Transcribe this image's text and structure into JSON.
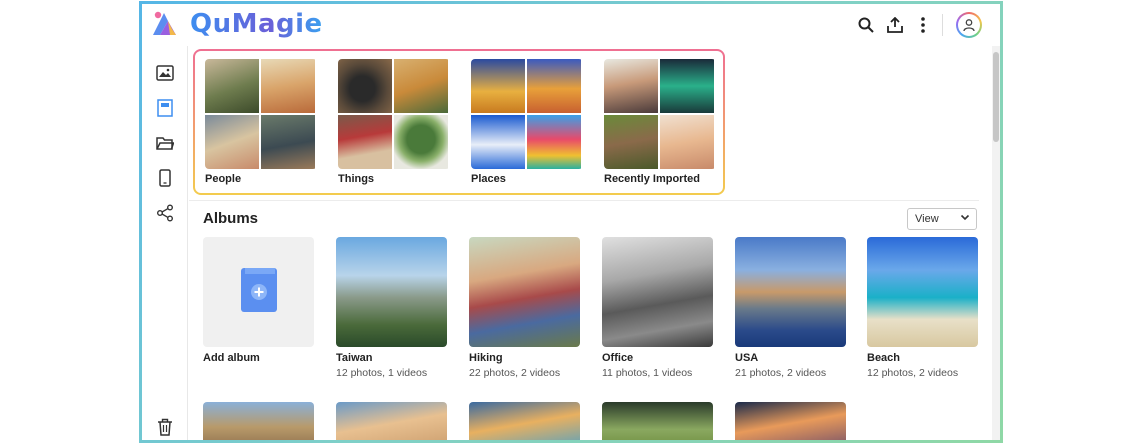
{
  "app": {
    "brand": "QuMagie"
  },
  "categories": [
    {
      "label": "People"
    },
    {
      "label": "Things"
    },
    {
      "label": "Places"
    },
    {
      "label": "Recently Imported"
    }
  ],
  "albums_section": {
    "title": "Albums",
    "view_label": "View"
  },
  "albums": [
    {
      "title": "Add album",
      "subtitle": ""
    },
    {
      "title": "Taiwan",
      "subtitle": "12 photos, 1 videos"
    },
    {
      "title": "Hiking",
      "subtitle": "22 photos, 2 videos"
    },
    {
      "title": "Office",
      "subtitle": "11 photos, 1 videos"
    },
    {
      "title": "USA",
      "subtitle": "21 photos, 2 videos"
    },
    {
      "title": "Beach",
      "subtitle": "12 photos, 2 videos"
    }
  ],
  "icons": {
    "topbar": [
      "search-icon",
      "upload-icon",
      "more-vertical-icon",
      "account-icon"
    ],
    "sidebar": [
      "photos-icon",
      "albums-icon",
      "folder-icon",
      "mobile-icon",
      "share-icon",
      "trash-icon"
    ]
  },
  "colors": {
    "accent": "#3d8ef0",
    "frame": "#7fc6e8",
    "category_border_top": "#ef6f92",
    "category_border_bottom": "#f3cc4e"
  }
}
